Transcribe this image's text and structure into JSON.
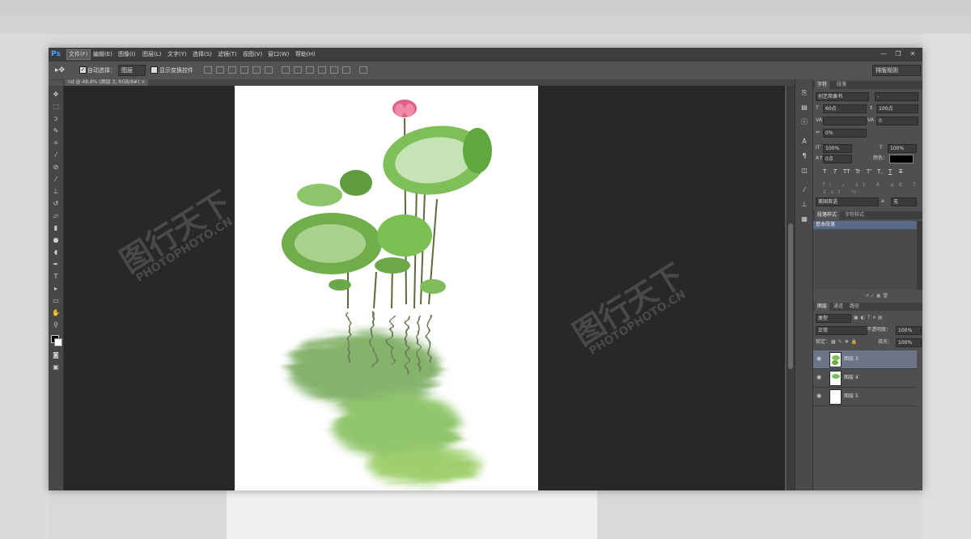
{
  "app": {
    "logo": "Ps",
    "menu": [
      "文件(F)",
      "编辑(E)",
      "图像(I)",
      "图层(L)",
      "文字(Y)",
      "选择(S)",
      "滤镜(T)",
      "视图(V)",
      "窗口(W)",
      "帮助(H)"
    ],
    "window_controls": [
      "—",
      "❐",
      "✕"
    ]
  },
  "options": {
    "auto_select_label": "自动选择：",
    "auto_select_value": "图层",
    "show_transform_label": "显示变换控件",
    "workspace": "排版规则"
  },
  "document": {
    "tab_title": "nd @ 48.8% (图层 3, RGB/8#)"
  },
  "watermark": {
    "logo_text": "图行天下",
    "url_text": "PHOTOPHOTO.CN"
  },
  "character_panel": {
    "tabs": [
      "字符",
      "段落"
    ],
    "font_family": "创艺简隶书",
    "font_style": "-",
    "font_size": "60点",
    "leading": "100点",
    "kerning": "",
    "tracking": "0",
    "scale_pct": "0%",
    "vertical_scale": "100%",
    "horizontal_scale": "100%",
    "baseline": "0点",
    "color_label": "颜色：",
    "color_value": "#000000",
    "style_buttons": [
      "T",
      "T",
      "TT",
      "Tr",
      "T'",
      "T,",
      "T",
      "T"
    ],
    "language": "美国英语",
    "aa_label": "a",
    "aa_value": "无"
  },
  "paragraph_styles_panel": {
    "tabs": [
      "段落样式",
      "字符样式"
    ],
    "items": [
      "基本段落"
    ]
  },
  "layers_panel": {
    "tabs": [
      "图层",
      "通道",
      "路径"
    ],
    "filter": "类型",
    "blend_mode": "正常",
    "opacity_label": "不透明度：",
    "opacity_value": "100%",
    "lock_label": "锁定：",
    "fill_label": "填充：",
    "fill_value": "100%",
    "layers": [
      {
        "name": "图层 3",
        "selected": true
      },
      {
        "name": "图层 4",
        "selected": false
      },
      {
        "name": "图层 5",
        "selected": false
      }
    ]
  }
}
